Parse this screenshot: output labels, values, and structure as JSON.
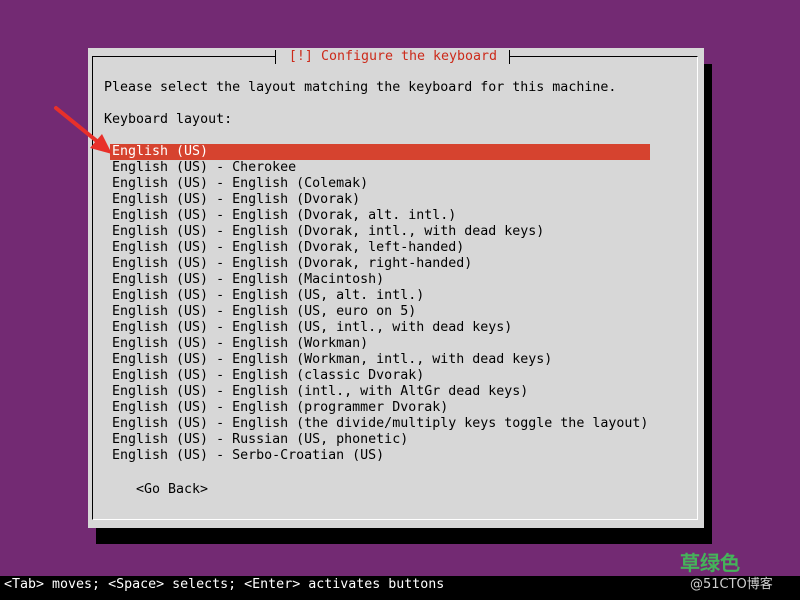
{
  "dialog": {
    "title": "[!] Configure the keyboard",
    "prompt": "Please select the layout matching the keyboard for this machine.",
    "layout_label": "Keyboard layout:",
    "selected_index": 0,
    "items": [
      "English (US)",
      "English (US) - Cherokee",
      "English (US) - English (Colemak)",
      "English (US) - English (Dvorak)",
      "English (US) - English (Dvorak, alt. intl.)",
      "English (US) - English (Dvorak, intl., with dead keys)",
      "English (US) - English (Dvorak, left-handed)",
      "English (US) - English (Dvorak, right-handed)",
      "English (US) - English (Macintosh)",
      "English (US) - English (US, alt. intl.)",
      "English (US) - English (US, euro on 5)",
      "English (US) - English (US, intl., with dead keys)",
      "English (US) - English (Workman)",
      "English (US) - English (Workman, intl., with dead keys)",
      "English (US) - English (classic Dvorak)",
      "English (US) - English (intl., with AltGr dead keys)",
      "English (US) - English (programmer Dvorak)",
      "English (US) - English (the divide/multiply keys toggle the layout)",
      "English (US) - Russian (US, phonetic)",
      "English (US) - Serbo-Croatian (US)"
    ],
    "go_back": "<Go Back>"
  },
  "status_bar": "<Tab> moves; <Space> selects; <Enter> activates buttons",
  "watermark": {
    "line1": "草绿色",
    "line2": "@51CTO博客"
  },
  "colors": {
    "background": "#732a73",
    "dialog": "#d7d7d7",
    "title": "#cc2a1a",
    "selection": "#d6432f",
    "arrow": "#e8302a",
    "status_bar": "#000000"
  },
  "icons": {
    "annotation": "red-arrow-icon"
  }
}
